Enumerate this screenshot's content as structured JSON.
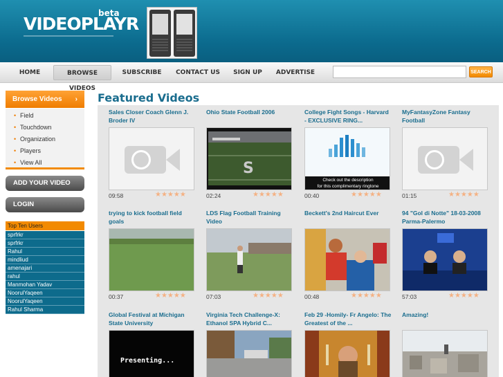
{
  "brand": {
    "logo": "VIDEOPLAYR",
    "badge": "beta"
  },
  "nav": {
    "items": [
      "HOME",
      "BROWSE VIDEOS",
      "SUBSCRIBE",
      "CONTACT US",
      "SIGN UP",
      "ADVERTISE"
    ],
    "active": "BROWSE VIDEOS",
    "search_value": "",
    "search_button": "SEARCH"
  },
  "sidebar": {
    "browse_label": "Browse Videos",
    "browse_items": [
      "Field",
      "Touchdown",
      "Organization",
      "Players",
      "View All"
    ],
    "add_video": "ADD YOUR VIDEO",
    "login": "LOGIN",
    "top_users_label": "Top Ten Users",
    "top_users": [
      "sprfrkr",
      "sprfrkr",
      "Rahul",
      "mindliud",
      "amenajari",
      "rahul",
      "Manmohan Yadav",
      "NoorulYaqeen",
      "NoorulYaqeen",
      "Rahul Sharma"
    ]
  },
  "main": {
    "title": "Featured Videos",
    "videos": [
      {
        "title": "Sales Closer Coach Glenn J. Broder IV",
        "duration": "09:58",
        "thumb": "placeholder-icon"
      },
      {
        "title": "Ohio State Football 2006",
        "duration": "02:24",
        "thumb": "football-field"
      },
      {
        "title": "College Fight Songs - Harvard - EXCLUSIVE RING...",
        "duration": "00:40",
        "thumb": "ringtone-ad",
        "thumb_caption_1": "Check out the description",
        "thumb_caption_2": "for this complimentary ringtone"
      },
      {
        "title": "MyFantasyZone Fantasy Football",
        "duration": "01:15",
        "thumb": "placeholder-icon"
      },
      {
        "title": "trying to kick football field goals",
        "duration": "00:37",
        "thumb": "grass-field"
      },
      {
        "title": "LDS Flag Football Training Video",
        "duration": "07:03",
        "thumb": "person-field"
      },
      {
        "title": "Beckett's 2nd Haircut Ever",
        "duration": "00:48",
        "thumb": "haircut"
      },
      {
        "title": "94 \"Gol di Notte\" 18-03-2008 Parma-Palermo",
        "duration": "57:03",
        "thumb": "tv-studio"
      },
      {
        "title": "Global Festival at Michigan State University",
        "duration": "",
        "thumb": "presenting",
        "thumb_text": "Presenting..."
      },
      {
        "title": "Virginia Tech Challenge-X: Ethanol SPA Hybrid C...",
        "duration": "",
        "thumb": "street"
      },
      {
        "title": "Feb 29 -Homily- Fr Angelo: The Greatest of the ...",
        "duration": "",
        "thumb": "priest"
      },
      {
        "title": "Amazing!",
        "duration": "",
        "thumb": "rooftop"
      }
    ]
  },
  "colors": {
    "header": "#0b6a8d",
    "accent": "#ef7d00",
    "title": "#1a6d8e"
  }
}
